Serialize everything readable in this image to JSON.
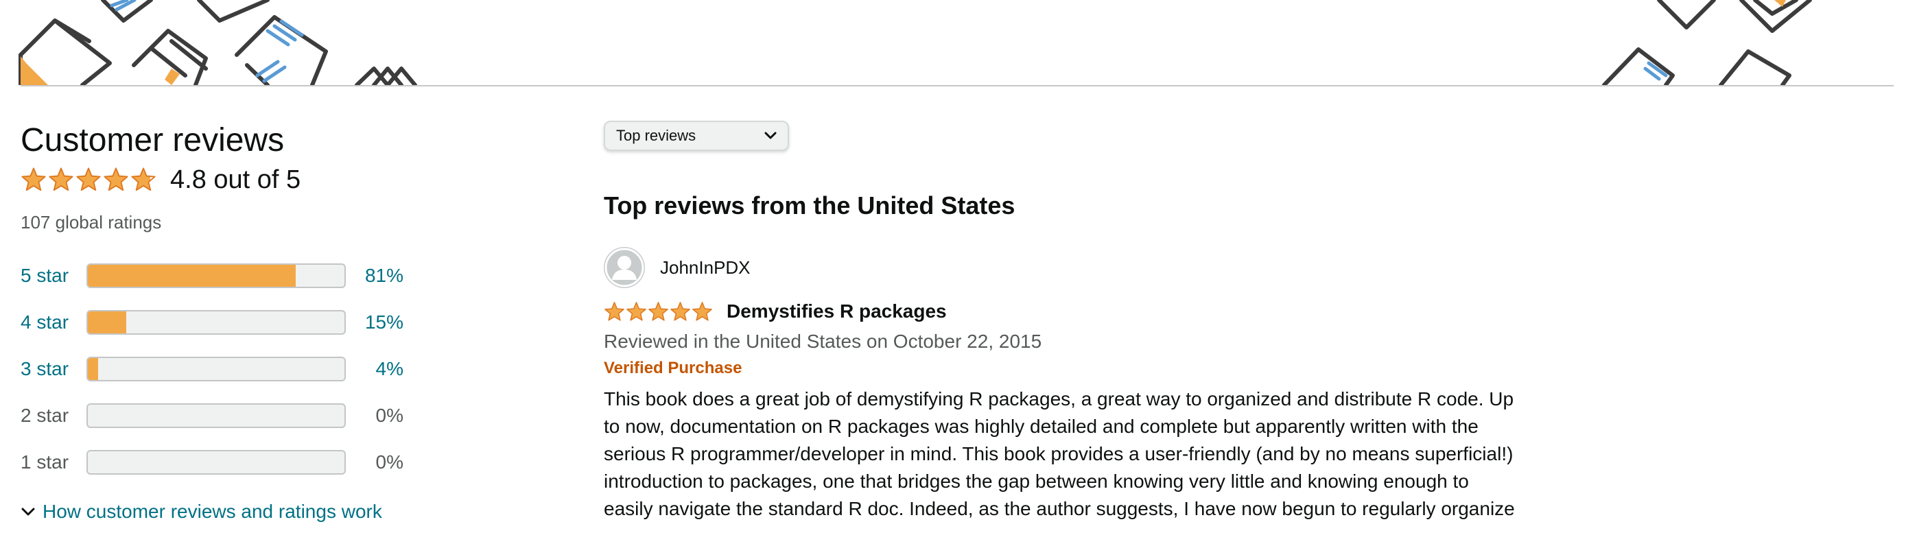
{
  "summary": {
    "heading": "Customer reviews",
    "average_rating": 4.8,
    "average_text": "4.8 out of 5",
    "global_ratings": "107 global ratings"
  },
  "histogram": [
    {
      "label": "5 star",
      "percent_text": "81%",
      "percent": 81
    },
    {
      "label": "4 star",
      "percent_text": "15%",
      "percent": 15
    },
    {
      "label": "3 star",
      "percent_text": "4%",
      "percent": 4
    },
    {
      "label": "2 star",
      "percent_text": "0%",
      "percent": 0
    },
    {
      "label": "1 star",
      "percent_text": "0%",
      "percent": 0
    }
  ],
  "how_link": "How customer reviews and ratings work",
  "sort": {
    "selected": "Top reviews"
  },
  "top_reviews_heading": "Top reviews from the United States",
  "review": {
    "username": "JohnInPDX",
    "rating": 5,
    "title": "Demystifies R packages",
    "date": "Reviewed in the United States on October 22, 2015",
    "verified": "Verified Purchase",
    "body_lines": [
      "This book does a great job of demystifying R packages, a great way to organized and distribute R code. Up",
      "to now, documentation on R packages was highly detailed and complete but apparently written with the",
      "serious R programmer/developer in mind. This book provides a user-friendly (and by no means superficial!)",
      "introduction to packages, one that bridges the gap between knowing very little and knowing enough to",
      "easily navigate the standard R doc. Indeed, as the author suggests, I have now begun to regularly organize"
    ]
  },
  "colors": {
    "star": "#f3a847",
    "link": "#007185",
    "verified": "#c45500",
    "muted": "#565959",
    "bar_bg": "#f0f2f2",
    "bar_border": "#c4c6c6",
    "banner_line": "#3c3c3c",
    "banner_blue": "#5a9bd5",
    "banner_orange": "#f3a847"
  },
  "icons": {
    "star": "star-icon",
    "chevron": "chevron-down-icon",
    "avatar": "avatar-silhouette-icon",
    "banner": "book-pattern-icons"
  }
}
